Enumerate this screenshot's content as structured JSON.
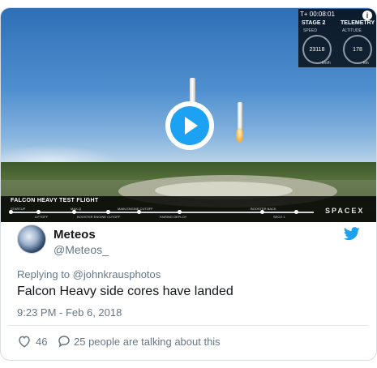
{
  "video": {
    "hud": {
      "time": "T+   00:08:01",
      "stage": "STAGE 2",
      "telemetry": "TELEMETRY",
      "speed_label": "SPEED",
      "altitude_label": "ALTITUDE",
      "speed_value": "23118",
      "speed_unit": "km/h",
      "altitude_value": "178",
      "altitude_unit": "km"
    },
    "flight_title": "FALCON HEAVY TEST FLIGHT",
    "timeline_labels": [
      "STARTUP",
      "LIFTOFF",
      "MAX-Q",
      "BOOSTER ENGINE CUTOFF",
      "MAIN ENGINE CUTOFF",
      "FAIRING DEPLOY",
      "BOOSTER BACK",
      "SECO 1"
    ],
    "brand": "SPACEX",
    "info_glyph": "i"
  },
  "author": {
    "name": "Meteos",
    "handle": "@Meteos_"
  },
  "tweet": {
    "replying_prefix": "Replying to",
    "replying_handle": "@johnkrausphotos",
    "text": "Falcon Heavy side cores have landed",
    "timestamp": "9:23 PM - Feb 6, 2018"
  },
  "actions": {
    "like_count": "46",
    "talking": "25 people are talking about this"
  },
  "colors": {
    "accent": "#1da1f2",
    "secondary_text": "#657786",
    "primary_text": "#14171a"
  },
  "icons": [
    "play-icon",
    "info-icon",
    "twitter-bird-icon",
    "heart-icon",
    "reply-bubble-icon"
  ]
}
